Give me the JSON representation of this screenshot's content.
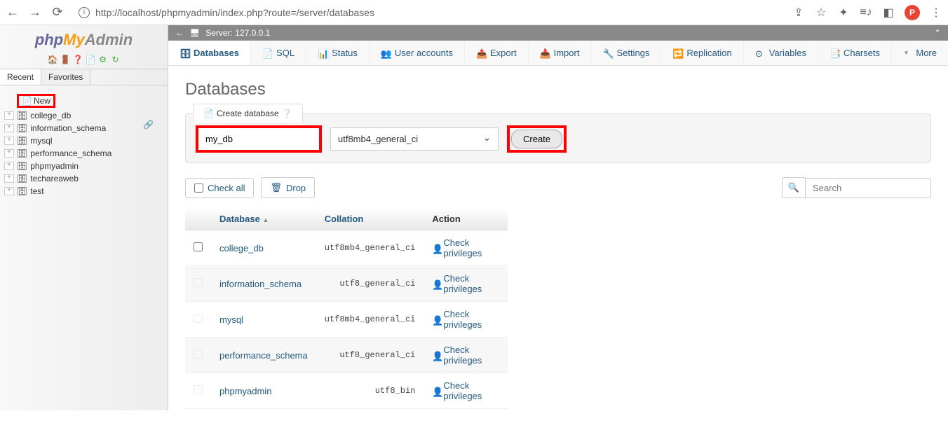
{
  "browser": {
    "url": "http://localhost/phpmyadmin/index.php?route=/server/databases",
    "profile_letter": "P"
  },
  "sidebar": {
    "logo_php": "php",
    "logo_my": "My",
    "logo_admin": "Admin",
    "tab_recent": "Recent",
    "tab_favorites": "Favorites",
    "new_label": "New",
    "databases": [
      {
        "name": "college_db"
      },
      {
        "name": "information_schema"
      },
      {
        "name": "mysql"
      },
      {
        "name": "performance_schema"
      },
      {
        "name": "phpmyadmin"
      },
      {
        "name": "techareaweb"
      },
      {
        "name": "test"
      }
    ]
  },
  "server_bar": {
    "label": "Server: 127.0.0.1"
  },
  "top_tabs": [
    {
      "label": "Databases",
      "active": true
    },
    {
      "label": "SQL"
    },
    {
      "label": "Status"
    },
    {
      "label": "User accounts"
    },
    {
      "label": "Export"
    },
    {
      "label": "Import"
    },
    {
      "label": "Settings"
    },
    {
      "label": "Replication"
    },
    {
      "label": "Variables"
    },
    {
      "label": "Charsets"
    },
    {
      "label": "More"
    }
  ],
  "page": {
    "title": "Databases",
    "create_header": "Create database",
    "db_name_value": "my_db",
    "collation_value": "utf8mb4_general_ci",
    "create_button": "Create",
    "check_all": "Check all",
    "drop": "Drop",
    "search_placeholder": "Search"
  },
  "table": {
    "col_database": "Database",
    "col_collation": "Collation",
    "col_action": "Action",
    "check_privileges": "Check privileges",
    "rows": [
      {
        "db": "college_db",
        "collation": "utf8mb4_general_ci",
        "enabled": true
      },
      {
        "db": "information_schema",
        "collation": "utf8_general_ci",
        "enabled": false
      },
      {
        "db": "mysql",
        "collation": "utf8mb4_general_ci",
        "enabled": false
      },
      {
        "db": "performance_schema",
        "collation": "utf8_general_ci",
        "enabled": false
      },
      {
        "db": "phpmyadmin",
        "collation": "utf8_bin",
        "enabled": false
      }
    ]
  }
}
